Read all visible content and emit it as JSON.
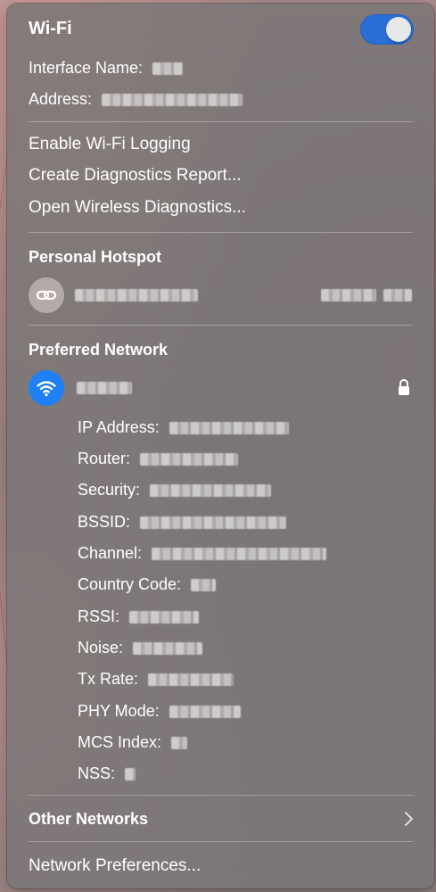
{
  "wifi": {
    "title": "Wi-Fi",
    "toggle_state": "on",
    "accent_color": "#2a6fd8"
  },
  "interface": {
    "name_label": "Interface Name:",
    "address_label": "Address:"
  },
  "actions": {
    "enable_logging": "Enable Wi-Fi Logging",
    "diagnostics_report": "Create Diagnostics Report...",
    "wireless_diagnostics": "Open Wireless Diagnostics..."
  },
  "hotspot": {
    "section_title": "Personal Hotspot",
    "icon": "link-icon"
  },
  "preferred": {
    "section_title": "Preferred Network",
    "icon": "wifi-icon",
    "lock_icon": "lock-icon",
    "details": [
      {
        "label": "IP Address:"
      },
      {
        "label": "Router:"
      },
      {
        "label": "Security:"
      },
      {
        "label": "BSSID:"
      },
      {
        "label": "Channel:"
      },
      {
        "label": "Country Code:"
      },
      {
        "label": "RSSI:"
      },
      {
        "label": "Noise:"
      },
      {
        "label": "Tx Rate:"
      },
      {
        "label": "PHY Mode:"
      },
      {
        "label": "MCS Index:"
      },
      {
        "label": "NSS:"
      }
    ]
  },
  "footer": {
    "other_networks": "Other Networks",
    "chevron_icon": "chevron-right-icon",
    "network_preferences": "Network Preferences..."
  }
}
